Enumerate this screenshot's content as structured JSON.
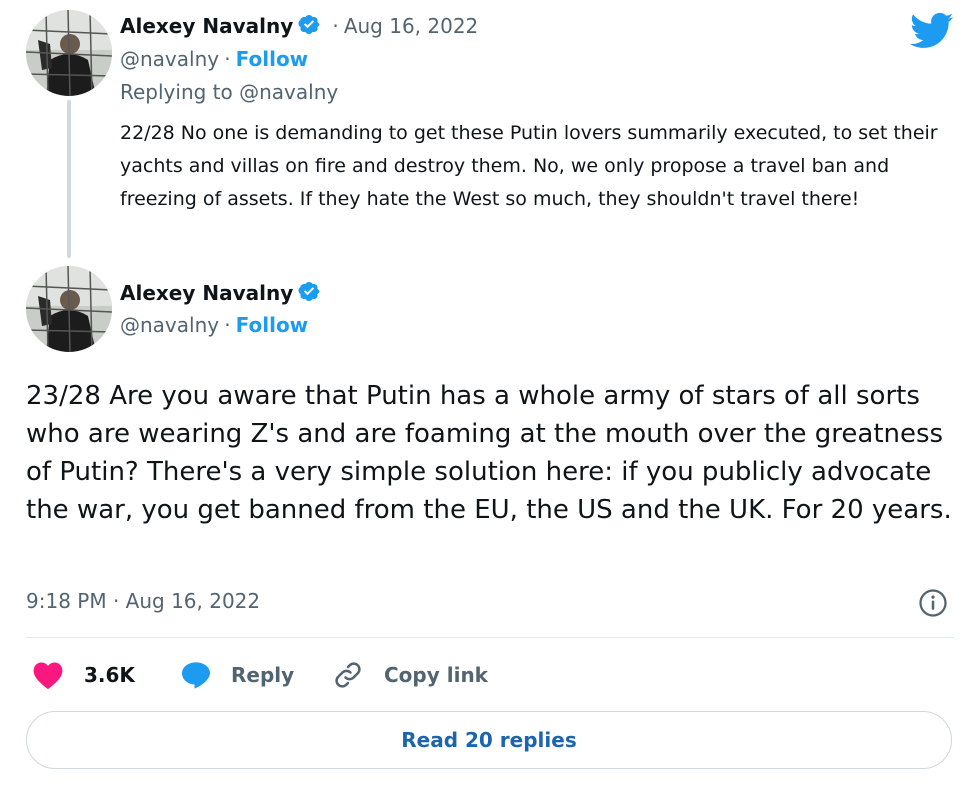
{
  "parent_tweet": {
    "author_name": "Alexey Navalny",
    "separator": "·",
    "date": "Aug 16, 2022",
    "handle": "@navalny",
    "follow_label": "Follow",
    "replying_to": "Replying to @navalny",
    "text": "22/28 No one is demanding to get these Putin lovers summarily executed, to set their yachts and villas on fire and destroy them. No, we only propose a travel ban and freezing of assets. If they hate the West so much, they shouldn't travel there!"
  },
  "main_tweet": {
    "author_name": "Alexey Navalny",
    "handle": "@navalny",
    "separator": "·",
    "follow_label": "Follow",
    "text": "23/28 Are you aware that Putin has a whole army of stars of all sorts who are wearing Z's and are foaming at the mouth over the greatness of Putin? There's a very simple solution here: if you publicly advocate the war, you get banned from the EU, the US and the UK. For 20 years.",
    "timestamp": "9:18 PM · Aug 16, 2022"
  },
  "actions": {
    "like_count": "3.6K",
    "reply_label": "Reply",
    "copy_link_label": "Copy link"
  },
  "read_replies_label": "Read 20 replies",
  "colors": {
    "accent": "#1d9bf0",
    "like": "#f91880",
    "text": "#0f1419",
    "muted": "#536471"
  }
}
